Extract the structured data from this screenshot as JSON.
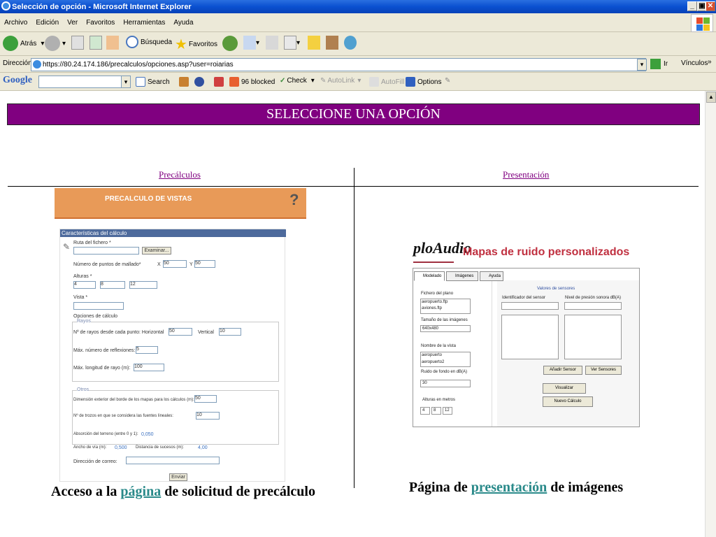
{
  "window": {
    "title": "Selección de opción - Microsoft Internet Explorer"
  },
  "menu": [
    "Archivo",
    "Edición",
    "Ver",
    "Favoritos",
    "Herramientas",
    "Ayuda"
  ],
  "toolbar": {
    "back": "Atrás",
    "search": "Búsqueda",
    "favorites": "Favoritos"
  },
  "address": {
    "label": "Dirección",
    "url": "https://80.24.174.186/precalculos/opciones.asp?user=roiarias",
    "go": "Ir",
    "links": "Vínculos"
  },
  "google": {
    "logo": "Google",
    "search": "Search",
    "blocked": "96 blocked",
    "check": "Check",
    "autolink": "AutoLink",
    "autofill": "AutoFill",
    "options": "Options"
  },
  "page": {
    "banner": "SELECCIONE UNA OPCIÓN",
    "col_left": "Precálculos",
    "col_right": "Presentación",
    "caption_left_pre": "Acceso a la ",
    "caption_left_link": "página",
    "caption_left_post": " de solicitud de precálculo",
    "caption_right_pre": "Página de ",
    "caption_right_link": "presentación",
    "caption_right_post": " de imágenes"
  },
  "precalc_image": {
    "banner": "PRECALCULO DE VISTAS",
    "form_title": "Características del cálculo",
    "ruta": "Ruta del fichero *",
    "examinar": "Examinar...",
    "num_puntos": "Número de puntos de mallado*",
    "x_label": "X",
    "x_val": "50",
    "y_label": "Y",
    "y_val": "50",
    "alturas": "Alturas *",
    "alt1": "4",
    "alt2": "8",
    "alt3": "12",
    "vista": "Vista *",
    "opciones": "Opciones de cálculo",
    "rayos": "Rayos",
    "n_rayos": "Nº de rayos desde cada punto: Horizontal",
    "horiz_val": "50",
    "vertical": "Vertical",
    "vert_val": "10",
    "max_reflex": "Máx. número de reflexiones:",
    "max_reflex_val": "5",
    "max_long": "Máx. longitud de rayo (m):",
    "max_long_val": "100",
    "otros": "Otros",
    "dim_borde": "Dimensión exterior del borde de los mapas para los cálculos (m):",
    "dim_val": "50",
    "n_trozos": "Nº de trozos en que se considera las fuentes lineales:",
    "n_trozos_val": "10",
    "absorcion": "Absorción del terreno (entre 0 y 1):",
    "absorcion_val": "0,050",
    "ancho": "Ancho de vía (m):",
    "ancho_val": "0,500",
    "distancia": "Distancia de sucesos (m):",
    "distancia_val": "4,00",
    "direccion": "Dirección de correo:",
    "enviar": "Enviar"
  },
  "present_image": {
    "logo": "ploAudio",
    "title": "Mapas de ruido personalizados",
    "tab1": "Modelado",
    "tab2": "Imágenes",
    "tab3": "Ayuda",
    "fichero_planos": "Fichero del plano",
    "file1": "aeropuerto.ftp",
    "file2": "aviones.ftp",
    "tamano": "Tamaño de las imágenes",
    "tamano_val": "640x480",
    "nombre_vista": "Nombre de la vista",
    "vista1": "aeropuerto",
    "vista2": "aeropuerto2",
    "ruido_fondo": "Ruido de fondo en dB(A)",
    "ruido_val": "30",
    "alturas": "Alturas en metros",
    "h1": "4",
    "h2": "8",
    "h3": "12",
    "valores_sensores": "Valores de sensores",
    "ident_sensor": "Identificador del sensor",
    "nivel_presion": "Nivel de presión sonora dB(A)",
    "anadir": "Añadir Sensor",
    "ver": "Ver Sensores",
    "visualizar": "Visualizar",
    "nuevo": "Nuevo Cálculo"
  }
}
